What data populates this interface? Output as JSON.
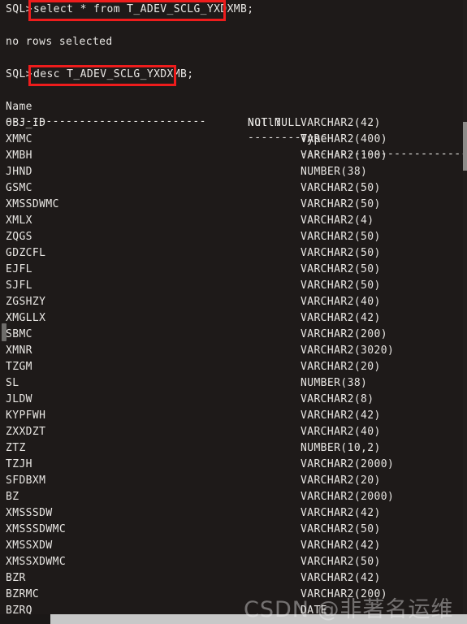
{
  "terminal": {
    "background_color": "#1e1a19",
    "text_color": "#e8e6e3",
    "highlight_color": "#ee1c1c",
    "prompt": "SQL>",
    "command_1": "select * from T_ADEV_SCLG_YXDXMB;",
    "result_1": "no rows selected",
    "command_2": "desc T_ADEV_SCLG_YXDXMB;"
  },
  "describe_table": {
    "headers": {
      "name": "Name",
      "null": "Null?",
      "type": "Type"
    },
    "separators": {
      "name": "------------------------------",
      "null": "--------",
      "type": "------------------------------"
    },
    "rows": [
      {
        "name": "OBJ_ID",
        "null": "NOT NULL",
        "type": "VARCHAR2(42)"
      },
      {
        "name": "XMMC",
        "null": "",
        "type": "VARCHAR2(400)"
      },
      {
        "name": "XMBH",
        "null": "",
        "type": "VARCHAR2(100)"
      },
      {
        "name": "JHND",
        "null": "",
        "type": "NUMBER(38)"
      },
      {
        "name": "GSMC",
        "null": "",
        "type": "VARCHAR2(50)"
      },
      {
        "name": "XMSSDWMC",
        "null": "",
        "type": "VARCHAR2(50)"
      },
      {
        "name": "XMLX",
        "null": "",
        "type": "VARCHAR2(4)"
      },
      {
        "name": "ZQGS",
        "null": "",
        "type": "VARCHAR2(50)"
      },
      {
        "name": "GDZCFL",
        "null": "",
        "type": "VARCHAR2(50)"
      },
      {
        "name": "EJFL",
        "null": "",
        "type": "VARCHAR2(50)"
      },
      {
        "name": "SJFL",
        "null": "",
        "type": "VARCHAR2(50)"
      },
      {
        "name": "ZGSHZY",
        "null": "",
        "type": "VARCHAR2(40)"
      },
      {
        "name": "XMGLLX",
        "null": "",
        "type": "VARCHAR2(42)"
      },
      {
        "name": "SBMC",
        "null": "",
        "type": "VARCHAR2(200)"
      },
      {
        "name": "XMNR",
        "null": "",
        "type": "VARCHAR2(3020)"
      },
      {
        "name": "TZGM",
        "null": "",
        "type": "VARCHAR2(20)"
      },
      {
        "name": "SL",
        "null": "",
        "type": "NUMBER(38)"
      },
      {
        "name": "JLDW",
        "null": "",
        "type": "VARCHAR2(8)"
      },
      {
        "name": "KYPFWH",
        "null": "",
        "type": "VARCHAR2(42)"
      },
      {
        "name": "ZXXDZT",
        "null": "",
        "type": "VARCHAR2(40)"
      },
      {
        "name": "ZTZ",
        "null": "",
        "type": "NUMBER(10,2)"
      },
      {
        "name": "TZJH",
        "null": "",
        "type": "VARCHAR2(2000)"
      },
      {
        "name": "SFDBXM",
        "null": "",
        "type": "VARCHAR2(20)"
      },
      {
        "name": "BZ",
        "null": "",
        "type": "VARCHAR2(2000)"
      },
      {
        "name": "XMSSSDW",
        "null": "",
        "type": "VARCHAR2(42)"
      },
      {
        "name": "XMSSSDWMC",
        "null": "",
        "type": "VARCHAR2(50)"
      },
      {
        "name": "XMSSXDW",
        "null": "",
        "type": "VARCHAR2(42)"
      },
      {
        "name": "XMSSXDWMC",
        "null": "",
        "type": "VARCHAR2(50)"
      },
      {
        "name": "BZR",
        "null": "",
        "type": "VARCHAR2(42)"
      },
      {
        "name": "BZRMC",
        "null": "",
        "type": "VARCHAR2(200)"
      },
      {
        "name": "BZRQ",
        "null": "",
        "type": "DATE"
      }
    ]
  },
  "watermark": {
    "text": "CSDN @非著名运维"
  }
}
